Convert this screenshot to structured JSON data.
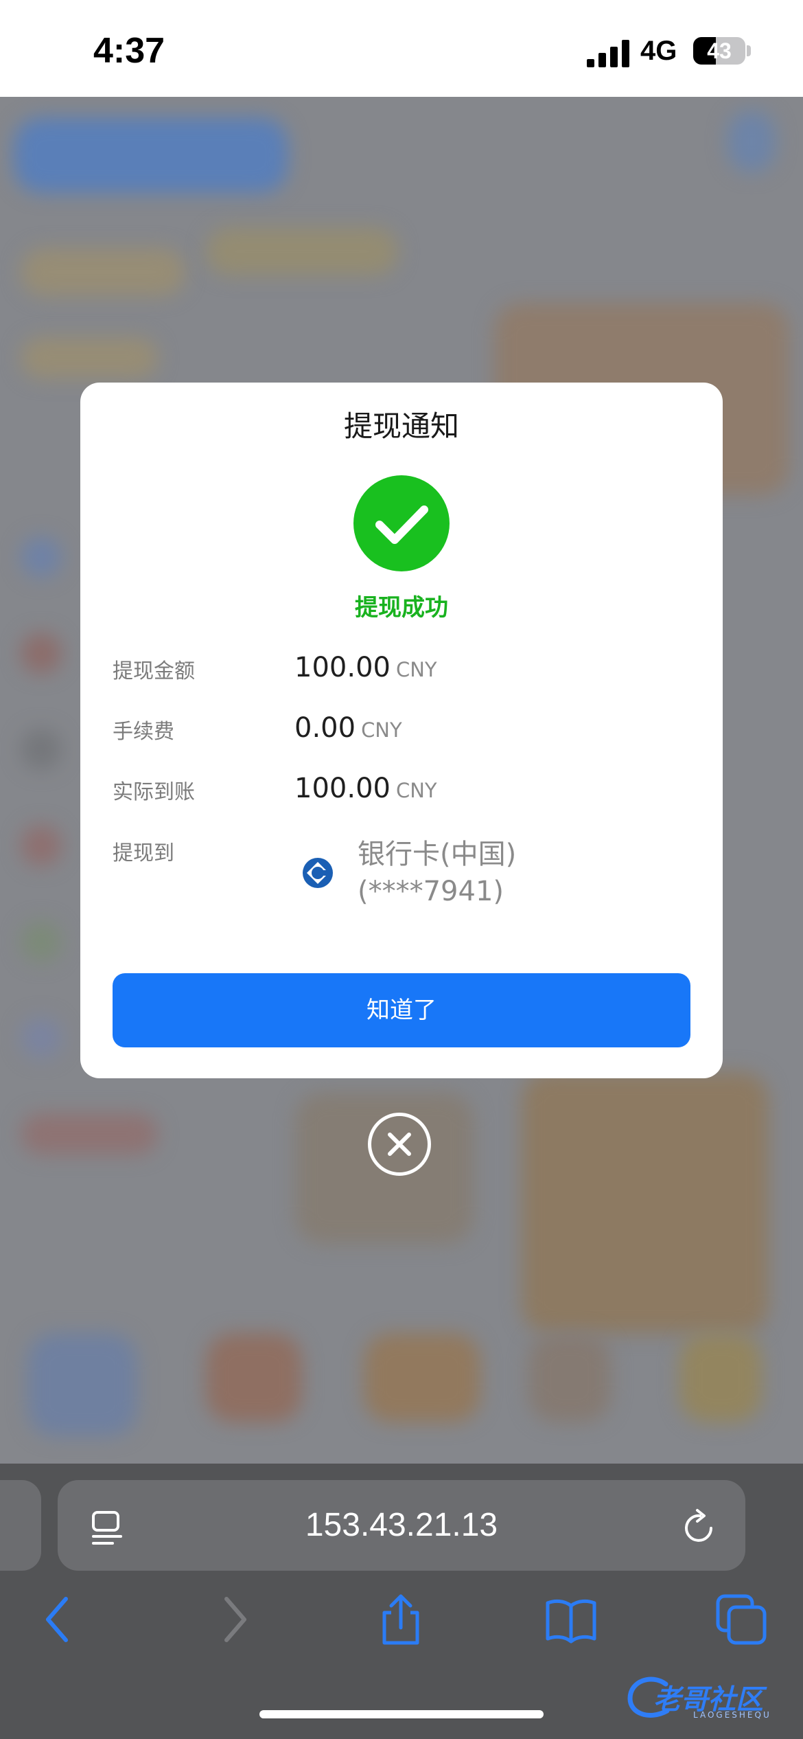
{
  "status_bar": {
    "time": "4:37",
    "network": "4G",
    "battery": "43",
    "battery_level": 0.43
  },
  "modal": {
    "title": "提现通知",
    "status_icon": "check-circle-icon",
    "status_text": "提现成功",
    "status_color": "#19c01f",
    "rows": [
      {
        "label": "提现金额",
        "value": "100.00",
        "unit": "CNY"
      },
      {
        "label": "手续费",
        "value": "0.00",
        "unit": "CNY"
      },
      {
        "label": "实际到账",
        "value": "100.00",
        "unit": "CNY"
      }
    ],
    "destination": {
      "label": "提现到",
      "bank_icon": "bank-logo-icon",
      "bank_name": "银行卡(中国)",
      "account": "(****7941)"
    },
    "confirm_label": "知道了",
    "accent_color": "#1877f8"
  },
  "close_icon": "close-circle-icon",
  "browser": {
    "url": "153.43.21.13",
    "icons": [
      "reader-icon",
      "reload-icon",
      "back-icon",
      "forward-icon",
      "share-icon",
      "bookmarks-icon",
      "tabs-icon"
    ]
  },
  "watermark": {
    "text": "老哥社区",
    "subtext": "LAOGESHEQU"
  }
}
